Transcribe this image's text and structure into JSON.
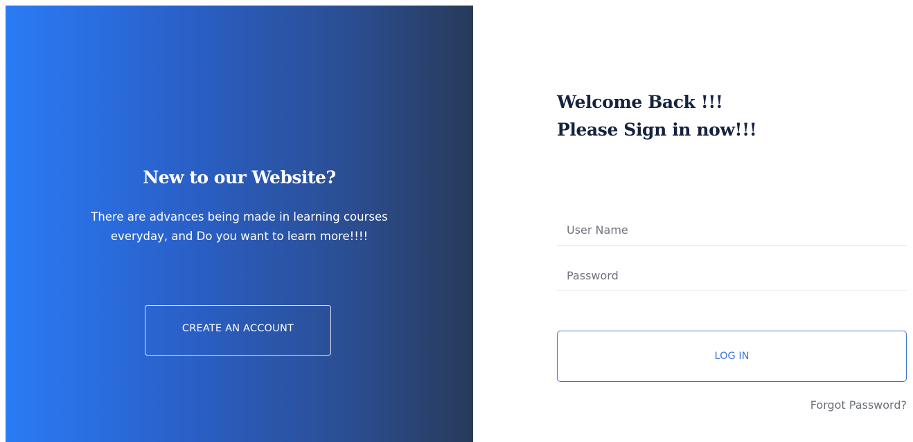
{
  "promo": {
    "title": "New to our Website?",
    "text": "There are advances being made in learning courses everyday, and Do you want to learn more!!!!",
    "create_button": "CREATE AN ACCOUNT",
    "gradient_start": "#2a7bf6",
    "gradient_end": "#283a5a"
  },
  "login": {
    "welcome": "Welcome Back !!!\nPlease Sign in now!!!",
    "username_placeholder": "User Name",
    "password_placeholder": "Password",
    "login_button": "LOG IN",
    "forgot_link": "Forgot Password?",
    "accent_color": "#3d73d6"
  }
}
